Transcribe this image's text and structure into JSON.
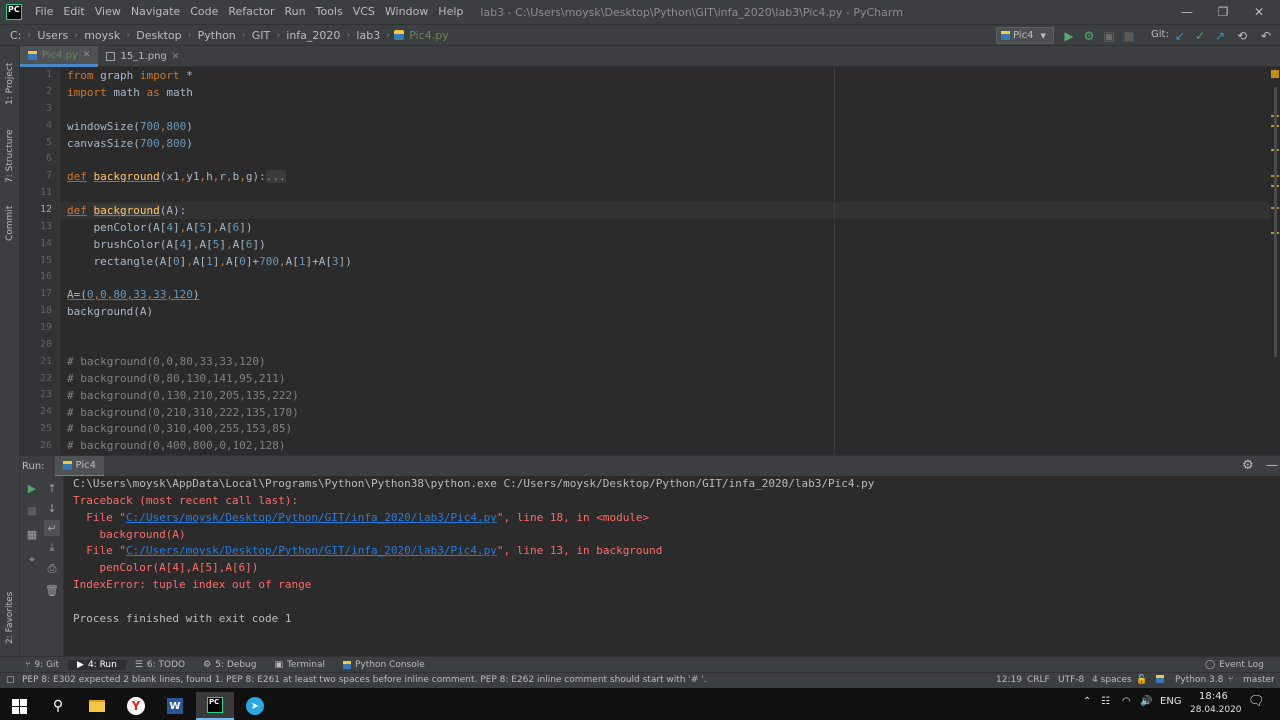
{
  "titlebar": {
    "menu": [
      "File",
      "Edit",
      "View",
      "Navigate",
      "Code",
      "Refactor",
      "Run",
      "Tools",
      "VCS",
      "Window",
      "Help"
    ],
    "window_title": "lab3 - C:\\Users\\moysk\\Desktop\\Python\\GIT\\infa_2020\\lab3\\Pic4.py - PyCharm",
    "logo_text": "PC"
  },
  "navbar": {
    "crumbs": [
      "C:",
      "Users",
      "moysk",
      "Desktop",
      "Python",
      "GIT",
      "infa_2020",
      "lab3",
      "Pic4.py"
    ],
    "run_config": "Pic4",
    "git_label": "Git:"
  },
  "left_strip": {
    "project": "1: Project",
    "structure": "7: Structure",
    "commit": "Commit",
    "favorites": "2: Favorites"
  },
  "editor_tabs": [
    {
      "label": "Pic4.py",
      "active": true
    },
    {
      "label": "15_1.png",
      "active": false
    }
  ],
  "editor": {
    "line_numbers": [
      "1",
      "2",
      "3",
      "4",
      "5",
      "6",
      "7",
      "11",
      "12",
      "13",
      "14",
      "15",
      "16",
      "17",
      "18",
      "19",
      "20",
      "21",
      "22",
      "23",
      "24",
      "25",
      "26"
    ]
  },
  "run_panel": {
    "label": "Run:",
    "config": "Pic4",
    "lines": {
      "cmd": "C:\\Users\\moysk\\AppData\\Local\\Programs\\Python\\Python38\\python.exe C:/Users/moysk/Desktop/Python/GIT/infa_2020/lab3/Pic4.py",
      "traceback": "Traceback (most recent call last):",
      "file1_pre": "  File \"",
      "file1_link": "C:/Users/moysk/Desktop/Python/GIT/infa_2020/lab3/Pic4.py",
      "file1_post": "\", line 18, in <module>",
      "code1": "    background(A)",
      "file2_pre": "  File \"",
      "file2_link": "C:/Users/moysk/Desktop/Python/GIT/infa_2020/lab3/Pic4.py",
      "file2_post": "\", line 13, in background",
      "code2": "    penColor(A[4],A[5],A[6])",
      "error": "IndexError: tuple index out of range",
      "finished": "Process finished with exit code 1"
    }
  },
  "tool_tabs": [
    {
      "label": "9: Git"
    },
    {
      "label": "4: Run"
    },
    {
      "label": "6: TODO"
    },
    {
      "label": "5: Debug"
    },
    {
      "label": "Terminal"
    },
    {
      "label": "Python Console"
    }
  ],
  "event_log": "Event Log",
  "statusbar": {
    "message": "PEP 8: E302 expected 2 blank lines, found 1. PEP 8: E261 at least two spaces before inline comment. PEP 8: E262 inline comment should start with '# '.",
    "position": "12:19",
    "line_sep": "CRLF",
    "encoding": "UTF-8",
    "indent": "4 spaces",
    "interpreter": "Python 3.8",
    "branch": "master"
  },
  "taskbar": {
    "lang": "ENG",
    "time": "18:46",
    "date": "28.04.2020"
  },
  "colors": {
    "accent": "#4a88c7",
    "keyword": "#cc7832",
    "number": "#6897bb",
    "error": "#ff6b68",
    "link": "#287bde"
  }
}
